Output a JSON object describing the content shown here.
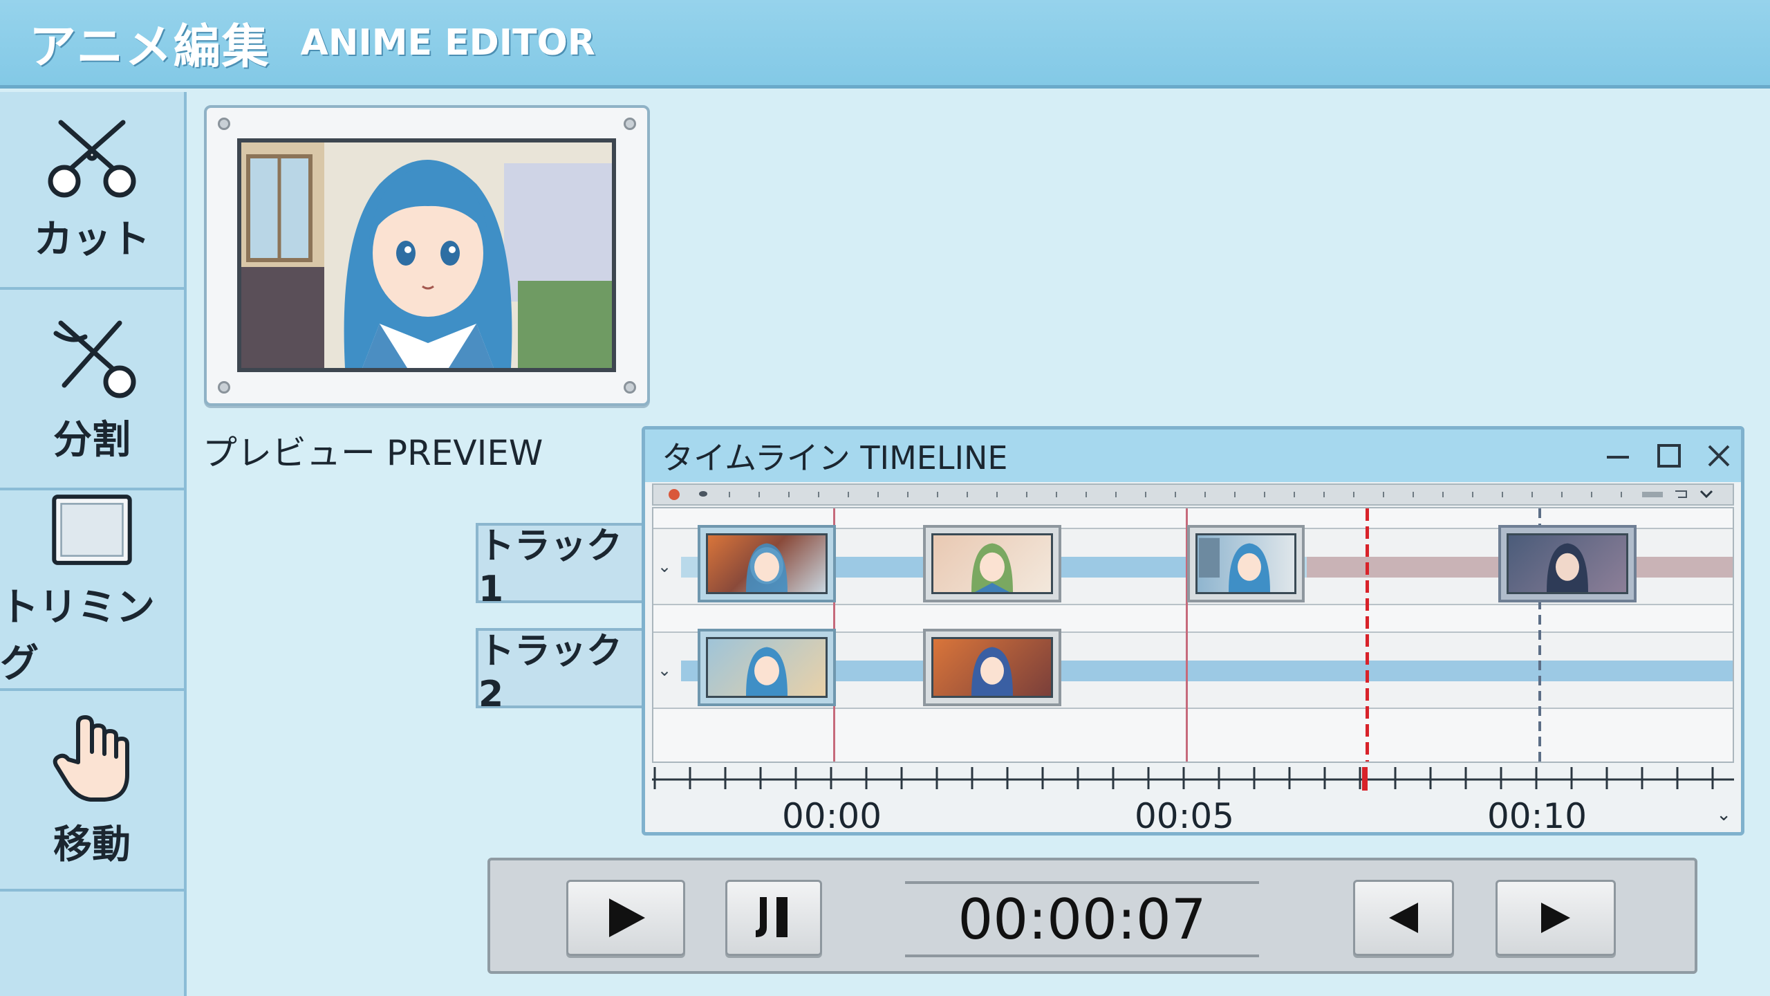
{
  "app": {
    "title_jp": "アニメ編集",
    "title_en": "ANIME EDITOR"
  },
  "sidebar": {
    "tools": [
      {
        "label": "カット",
        "icon": "scissors-icon"
      },
      {
        "label": "分割",
        "icon": "split-icon"
      },
      {
        "label": "トリミング",
        "icon": "trim-frame-icon"
      },
      {
        "label": "移動",
        "icon": "hand-icon"
      }
    ]
  },
  "preview": {
    "label": "プレビュー PREVIEW"
  },
  "timeline": {
    "title": "タイムライン TIMELINE",
    "tracks": [
      {
        "label": "トラック1"
      },
      {
        "label": "トラック2"
      }
    ],
    "time_labels": [
      "00:00",
      "00:05",
      "00:10"
    ]
  },
  "transport": {
    "timecode": "00:00:07"
  },
  "colors": {
    "accent": "#83c9e6",
    "playhead": "#d8232a",
    "band_blue": "#9cc9e4",
    "band_rose": "#c9b3b6"
  }
}
